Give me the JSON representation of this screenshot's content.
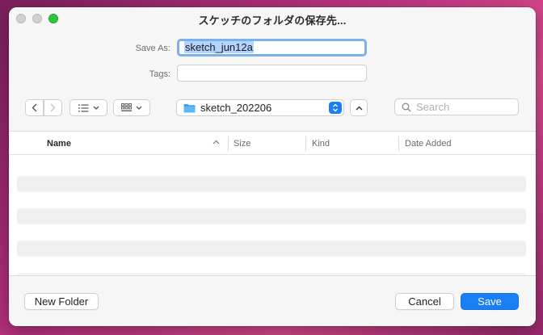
{
  "window": {
    "title": "スケッチのフォルダの保存先...",
    "accent_color": "#1a7ef5"
  },
  "form": {
    "save_as_label": "Save As:",
    "filename_value": "sketch_jun12a",
    "tags_label": "Tags:",
    "tags_value": ""
  },
  "toolbar": {
    "back_icon": "chevron-left-icon",
    "forward_icon": "chevron-right-icon",
    "view_list_icon": "list-view-icon",
    "view_grid_icon": "grid-view-icon",
    "location_name": "sketch_202206",
    "location_icon": "folder-icon",
    "search_placeholder": "Search"
  },
  "file_list": {
    "columns": [
      "Name",
      "Size",
      "Kind",
      "Date Added"
    ],
    "sort_column": "Name",
    "sort_direction": "ascending",
    "rows": []
  },
  "buttons": {
    "new_folder": "New Folder",
    "cancel": "Cancel",
    "save": "Save"
  }
}
